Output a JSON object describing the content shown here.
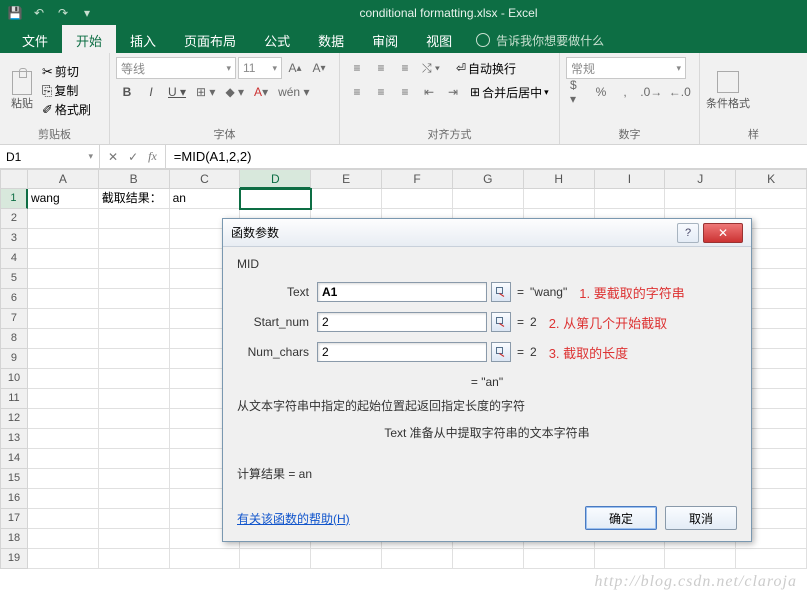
{
  "title": "conditional formatting.xlsx - Excel",
  "tabs": [
    "文件",
    "开始",
    "插入",
    "页面布局",
    "公式",
    "数据",
    "审阅",
    "视图"
  ],
  "tell_me": "告诉我你想要做什么",
  "ribbon": {
    "clipboard": {
      "paste": "粘贴",
      "cut": "剪切",
      "copy": "复制",
      "format_painter": "格式刷",
      "label": "剪贴板"
    },
    "font": {
      "name": "等线",
      "size": "11",
      "label": "字体"
    },
    "align": {
      "wrap": "自动换行",
      "merge": "合并后居中",
      "label": "对齐方式"
    },
    "number": {
      "format": "常规",
      "label": "数字"
    },
    "styles": {
      "cond": "条件格式",
      "label": "样"
    }
  },
  "namebox": "D1",
  "formula": "=MID(A1,2,2)",
  "cols": [
    "A",
    "B",
    "C",
    "D",
    "E",
    "F",
    "G",
    "H",
    "I",
    "J",
    "K"
  ],
  "active_col": "D",
  "rows": 19,
  "active_row": 1,
  "cells": {
    "A1": "wang",
    "B1": "截取结果：",
    "C1": "an"
  },
  "dialog": {
    "title": "函数参数",
    "fn": "MID",
    "params": [
      {
        "label": "Text",
        "value": "A1",
        "result": "\"wang\"",
        "anno": "1. 要截取的字符串",
        "bold": true
      },
      {
        "label": "Start_num",
        "value": "2",
        "result": "2",
        "anno": "2. 从第几个开始截取",
        "bold": false
      },
      {
        "label": "Num_chars",
        "value": "2",
        "result": "2",
        "anno": "3. 截取的长度",
        "bold": false
      }
    ],
    "overall_result": "=  \"an\"",
    "desc1": "从文本字符串中指定的起始位置起返回指定长度的字符",
    "desc2": "Text  准备从中提取字符串的文本字符串",
    "calc_label": "计算结果 =  an",
    "help": "有关该函数的帮助(H)",
    "ok": "确定",
    "cancel": "取消"
  },
  "watermark": "http://blog.csdn.net/claroja"
}
